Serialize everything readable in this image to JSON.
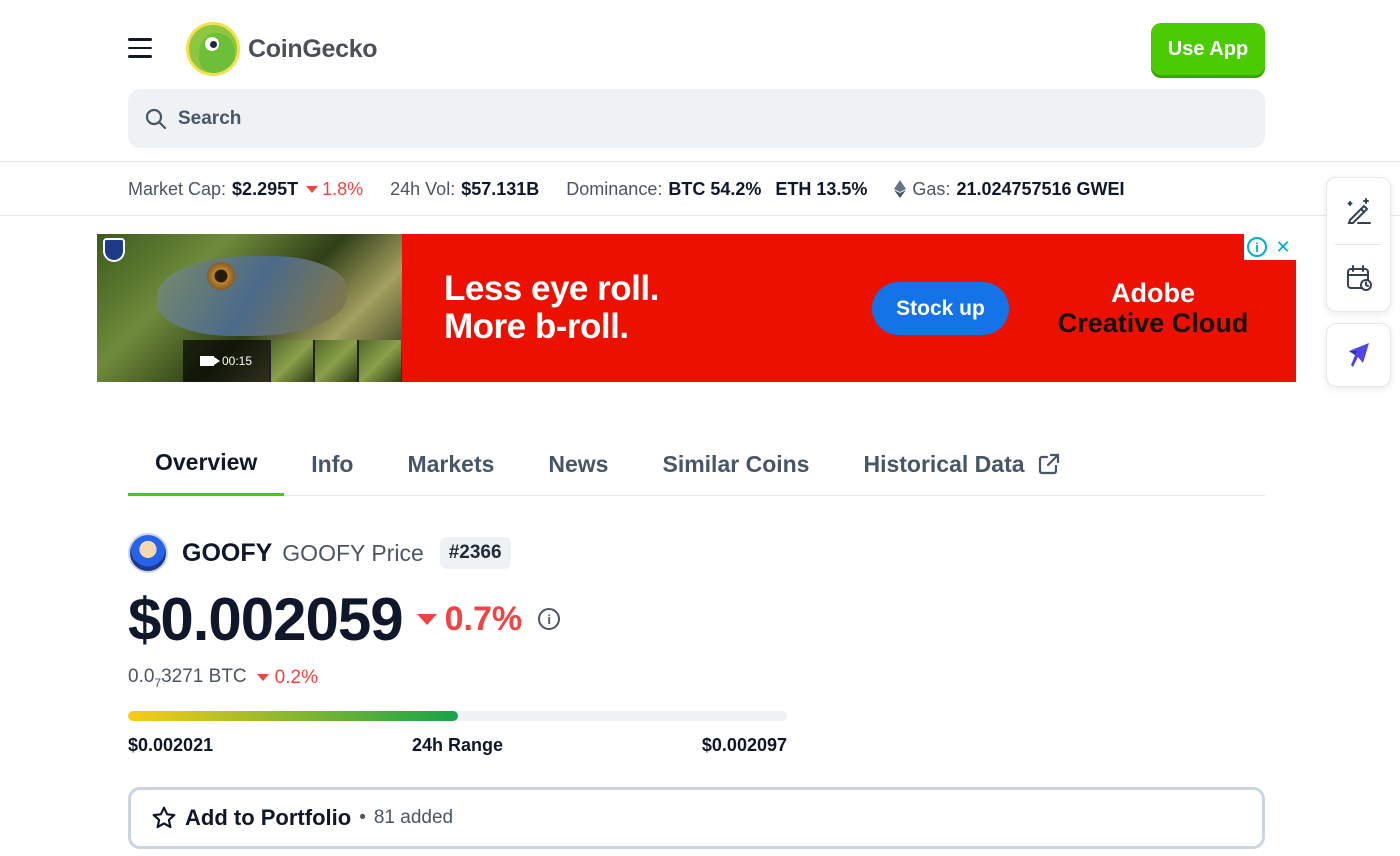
{
  "brand": {
    "name": "CoinGecko",
    "use_app_label": "Use App"
  },
  "search": {
    "placeholder": "Search"
  },
  "global_stats": {
    "market_cap_label": "Market Cap:",
    "market_cap_value": "$2.295T",
    "market_cap_change": "1.8%",
    "vol_label": "24h Vol:",
    "vol_value": "$57.131B",
    "dominance_label": "Dominance:",
    "dominance_btc": "BTC 54.2%",
    "dominance_eth": "ETH 13.5%",
    "gas_label": "Gas:",
    "gas_value": "21.024757516 GWEI"
  },
  "ad": {
    "video_time": "00:15",
    "headline_1": "Less eye roll.",
    "headline_2": "More b-roll.",
    "cta": "Stock up",
    "brand_1": "Adobe",
    "brand_2": "Creative Cloud"
  },
  "tabs": [
    {
      "label": "Overview",
      "active": true
    },
    {
      "label": "Info"
    },
    {
      "label": "Markets"
    },
    {
      "label": "News"
    },
    {
      "label": "Similar Coins"
    },
    {
      "label": "Historical Data"
    }
  ],
  "coin": {
    "name": "GOOFY",
    "subtitle": "GOOFY Price",
    "rank": "#2366",
    "price": "$0.002059",
    "change_24h": "0.7%",
    "btc_prefix": "0.0",
    "btc_sub": "7",
    "btc_rest": "3271 BTC",
    "btc_change": "0.2%",
    "range_low": "$0.002021",
    "range_label": "24h Range",
    "range_high": "$0.002097",
    "range_position": 0.5
  },
  "portfolio": {
    "label": "Add to Portfolio",
    "separator": "•",
    "count": "81 added"
  },
  "colors": {
    "accent_green": "#4bcc00",
    "down_red": "#ef4444",
    "ad_red": "#eb1000",
    "ad_blue": "#1473e6"
  }
}
